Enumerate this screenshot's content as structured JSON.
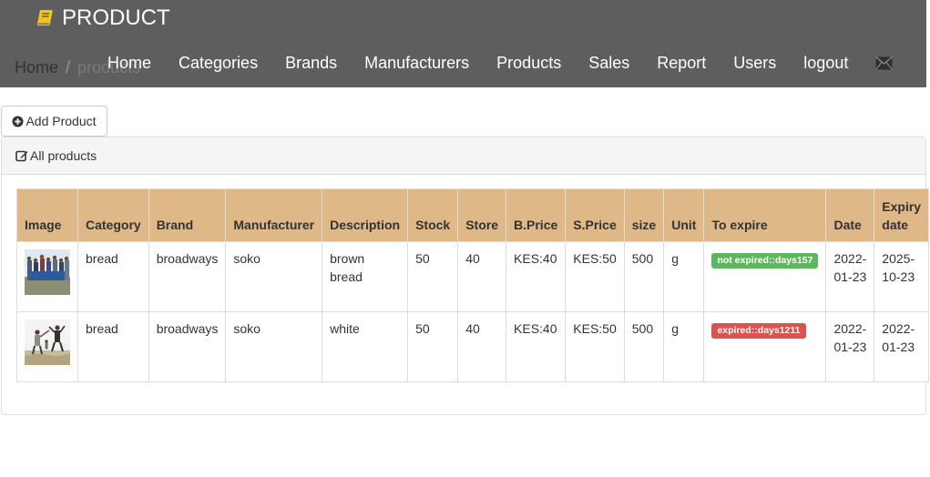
{
  "header": {
    "brand": "PRODUCT",
    "nav": [
      "Home",
      "Categories",
      "Brands",
      "Manufacturers",
      "Products",
      "Sales",
      "Report",
      "Users",
      "logout"
    ],
    "breadcrumb": {
      "home": "Home",
      "separator": "/",
      "current": "products"
    }
  },
  "actions": {
    "add_label": "Add Product"
  },
  "panel": {
    "title": "All products"
  },
  "table": {
    "headers": [
      "Image",
      "Category",
      "Brand",
      "Manufacturer",
      "Description",
      "Stock",
      "Store",
      "B.Price",
      "S.Price",
      "size",
      "Unit",
      "To expire",
      "Date",
      "Expiry date"
    ],
    "rows": [
      {
        "category": "bread",
        "brand": "broadways",
        "manufacturer": "soko",
        "description": "brown bread",
        "stock": "50",
        "store": "40",
        "bprice": "KES:40",
        "sprice": "KES:50",
        "size": "500",
        "unit": "g",
        "expire_status": "not expired::days157",
        "date": "2022-01-23",
        "expiry": "2025-10-23"
      },
      {
        "category": "bread",
        "brand": "broadways",
        "manufacturer": "soko",
        "description": "white",
        "stock": "50",
        "store": "40",
        "bprice": "KES:40",
        "sprice": "KES:50",
        "size": "500",
        "unit": "g",
        "expire_status": "expired::days1211",
        "date": "2022-01-23",
        "expiry": "2022-01-23"
      }
    ]
  },
  "colors": {
    "navbar": "#5e5e5e",
    "table_header": "#deb887",
    "success": "#5cb85c",
    "danger": "#d9534f",
    "brand_icon": "#f0c419"
  },
  "icons": {
    "brand": "book-icon",
    "mail": "envelope-icon",
    "add": "plus-circle-icon",
    "panel": "edit-icon"
  }
}
